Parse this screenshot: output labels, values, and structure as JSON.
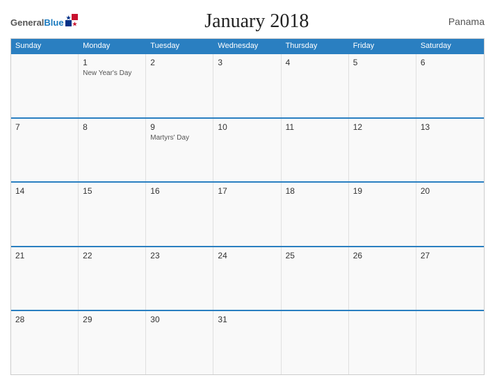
{
  "header": {
    "logo": {
      "general": "General",
      "blue": "Blue",
      "flag_title": "GeneralBlue logo flag"
    },
    "title": "January 2018",
    "country": "Panama"
  },
  "calendar": {
    "days_of_week": [
      "Sunday",
      "Monday",
      "Tuesday",
      "Wednesday",
      "Thursday",
      "Friday",
      "Saturday"
    ],
    "weeks": [
      [
        {
          "date": "",
          "event": ""
        },
        {
          "date": "1",
          "event": "New Year's Day"
        },
        {
          "date": "2",
          "event": ""
        },
        {
          "date": "3",
          "event": ""
        },
        {
          "date": "4",
          "event": ""
        },
        {
          "date": "5",
          "event": ""
        },
        {
          "date": "6",
          "event": ""
        }
      ],
      [
        {
          "date": "7",
          "event": ""
        },
        {
          "date": "8",
          "event": ""
        },
        {
          "date": "9",
          "event": "Martyrs' Day"
        },
        {
          "date": "10",
          "event": ""
        },
        {
          "date": "11",
          "event": ""
        },
        {
          "date": "12",
          "event": ""
        },
        {
          "date": "13",
          "event": ""
        }
      ],
      [
        {
          "date": "14",
          "event": ""
        },
        {
          "date": "15",
          "event": ""
        },
        {
          "date": "16",
          "event": ""
        },
        {
          "date": "17",
          "event": ""
        },
        {
          "date": "18",
          "event": ""
        },
        {
          "date": "19",
          "event": ""
        },
        {
          "date": "20",
          "event": ""
        }
      ],
      [
        {
          "date": "21",
          "event": ""
        },
        {
          "date": "22",
          "event": ""
        },
        {
          "date": "23",
          "event": ""
        },
        {
          "date": "24",
          "event": ""
        },
        {
          "date": "25",
          "event": ""
        },
        {
          "date": "26",
          "event": ""
        },
        {
          "date": "27",
          "event": ""
        }
      ],
      [
        {
          "date": "28",
          "event": ""
        },
        {
          "date": "29",
          "event": ""
        },
        {
          "date": "30",
          "event": ""
        },
        {
          "date": "31",
          "event": ""
        },
        {
          "date": "",
          "event": ""
        },
        {
          "date": "",
          "event": ""
        },
        {
          "date": "",
          "event": ""
        }
      ]
    ]
  }
}
